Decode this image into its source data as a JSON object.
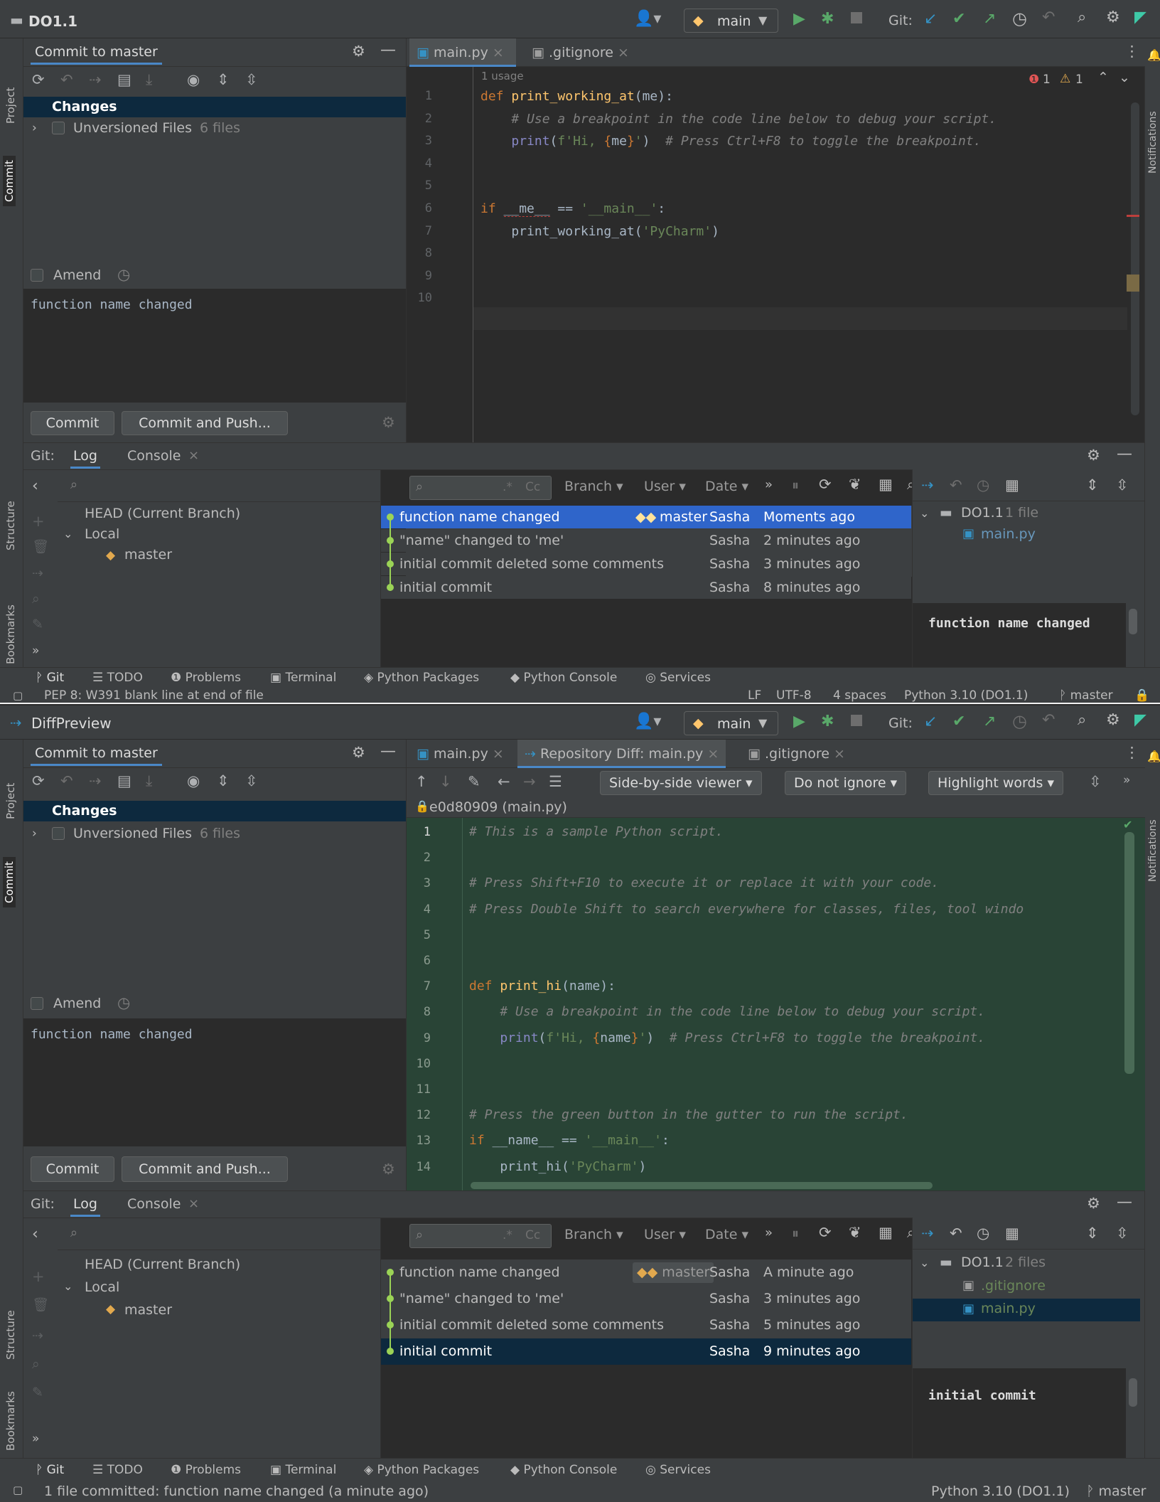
{
  "top": {
    "project": "DO1.1",
    "run_config": "main",
    "git_label": "Git:",
    "commit_panel_title": "Commit to master",
    "changes_label": "Changes",
    "unversioned_label": "Unversioned Files",
    "unversioned_count": "6 files",
    "amend_label": "Amend",
    "commit_message": "function name changed",
    "commit_btn": "Commit",
    "commit_push_btn": "Commit and Push...",
    "tabs": [
      "main.py",
      ".gitignore"
    ],
    "usage_hint": "1 usage",
    "errors": "1",
    "warnings": "1",
    "code_lines": [
      "1",
      "2",
      "3",
      "4",
      "5",
      "6",
      "7",
      "8",
      "9",
      "10"
    ],
    "git_tabs": {
      "git": "Git:",
      "log": "Log",
      "console": "Console"
    },
    "filters": {
      "branch": "Branch",
      "user": "User",
      "date": "Date"
    },
    "tree": {
      "head": "HEAD (Current Branch)",
      "local": "Local",
      "master": "master"
    },
    "commits": [
      {
        "msg": "function name changed",
        "tag": "master",
        "author": "Sasha",
        "time": "Moments ago"
      },
      {
        "msg": "\"name\" changed to 'me'",
        "author": "Sasha",
        "time": "2 minutes ago"
      },
      {
        "msg": "initial commit deleted some comments",
        "author": "Sasha",
        "time": "3 minutes ago"
      },
      {
        "msg": "initial commit",
        "author": "Sasha",
        "time": "8 minutes ago"
      }
    ],
    "details": {
      "root": "DO1.1",
      "root_count": "1 file",
      "file": "main.py",
      "message": "function name changed"
    },
    "toolwindows": [
      "Git",
      "TODO",
      "Problems",
      "Terminal",
      "Python Packages",
      "Python Console",
      "Services"
    ],
    "status": {
      "msg": "PEP 8: W391 blank line at end of file",
      "lf": "LF",
      "enc": "UTF-8",
      "indent": "4 spaces",
      "interp": "Python 3.10 (DO1.1)",
      "branch": "master"
    },
    "vtabs": {
      "project": "Project",
      "commit": "Commit",
      "structure": "Structure",
      "bookmarks": "Bookmarks",
      "notifications": "Notifications"
    }
  },
  "bottom": {
    "title": "DiffPreview",
    "run_config": "main",
    "commit_panel_title": "Commit to master",
    "changes_label": "Changes",
    "unversioned_label": "Unversioned Files",
    "unversioned_count": "6 files",
    "amend_label": "Amend",
    "commit_message": "function name changed",
    "commit_btn": "Commit",
    "commit_push_btn": "Commit and Push...",
    "tabs": [
      "main.py",
      "Repository Diff: main.py",
      ".gitignore"
    ],
    "viewer": "Side-by-side viewer",
    "ignore": "Do not ignore",
    "highlight": "Highlight words",
    "revision": "e0d80909 (main.py)",
    "line_nums": [
      "1",
      "2",
      "3",
      "4",
      "5",
      "6",
      "7",
      "8",
      "9",
      "10",
      "11",
      "12",
      "13",
      "14"
    ],
    "commits": [
      {
        "msg": "function name changed",
        "tag": "master",
        "author": "Sasha",
        "time": "A minute ago"
      },
      {
        "msg": "\"name\" changed to 'me'",
        "author": "Sasha",
        "time": "3 minutes ago"
      },
      {
        "msg": "initial commit deleted some comments",
        "author": "Sasha",
        "time": "5 minutes ago"
      },
      {
        "msg": "initial commit",
        "author": "Sasha",
        "time": "9 minutes ago"
      }
    ],
    "details": {
      "root": "DO1.1",
      "root_count": "2 files",
      "file1": ".gitignore",
      "file2": "main.py",
      "message": "initial commit"
    },
    "status": {
      "msg": "1 file committed: function name changed (a minute ago)",
      "interp": "Python 3.10 (DO1.1)",
      "branch": "master"
    }
  },
  "colors": {
    "accent": "#4a88c7",
    "selection": "#2f65ca",
    "diff_added": "#294436"
  }
}
